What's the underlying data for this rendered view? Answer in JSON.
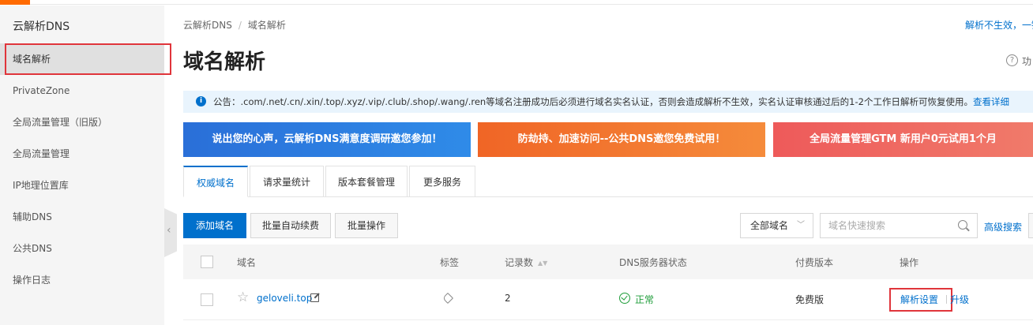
{
  "sidebar": {
    "title": "云解析DNS",
    "items": [
      {
        "label": "域名解析",
        "active": true
      },
      {
        "label": "PrivateZone"
      },
      {
        "label": "全局流量管理（旧版）"
      },
      {
        "label": "全局流量管理"
      },
      {
        "label": "IP地理位置库"
      },
      {
        "label": "辅助DNS"
      },
      {
        "label": "公共DNS"
      },
      {
        "label": "操作日志"
      }
    ]
  },
  "breadcrumb": {
    "root": "云解析DNS",
    "sep": "/",
    "current": "域名解析"
  },
  "header": {
    "top_link": "解析不生效，一键",
    "title": "域名解析",
    "help_icon_glyph": "?",
    "help_text": "功"
  },
  "notice": {
    "icon_glyph": "i",
    "text": "公告：.com/.net/.cn/.xin/.top/.xyz/.vip/.club/.shop/.wang/.ren等域名注册成功后必须进行域名实名认证，否则会造成解析不生效，实名认证审核通过后的1-2个工作日解析可恢复使用。",
    "link": "查看详细"
  },
  "banners": [
    {
      "text": "说出您的心声，云解析DNS满意度调研邀您参加！",
      "color": "#2a6fd8"
    },
    {
      "text": "防劫持、加速访问--公共DNS邀您免费试用！",
      "color": "#f06526"
    },
    {
      "text": "全局流量管理GTM 新用户0元试用1个月",
      "color": "#ee5a5a"
    }
  ],
  "tabs": [
    {
      "label": "权威域名",
      "active": true
    },
    {
      "label": "请求量统计"
    },
    {
      "label": "版本套餐管理"
    },
    {
      "label": "更多服务"
    }
  ],
  "toolbar": {
    "add_domain": "添加域名",
    "batch_renew": "批量自动续费",
    "batch_ops": "批量操作",
    "domain_filter": "全部域名",
    "filter_chevron": "﹀",
    "search_placeholder": "域名快速搜索",
    "advanced_search": "高级搜索"
  },
  "table": {
    "headers": {
      "domain": "域名",
      "tags": "标签",
      "records": "记录数",
      "sort_glyph": "▲▼",
      "dns_status": "DNS服务器状态",
      "edition": "付费版本",
      "actions": "操作"
    },
    "rows": [
      {
        "star_glyph": "☆",
        "domain": "geloveli.top",
        "records": "2",
        "dns_status": "正常",
        "edition": "免费版",
        "action_primary": "解析设置",
        "action_secondary": "升级"
      }
    ]
  },
  "colors": {
    "accent": "#0070cc",
    "brand_orange": "#ff6a00",
    "ok_green": "#1f9d3a",
    "highlight_red": "#e0353b"
  }
}
